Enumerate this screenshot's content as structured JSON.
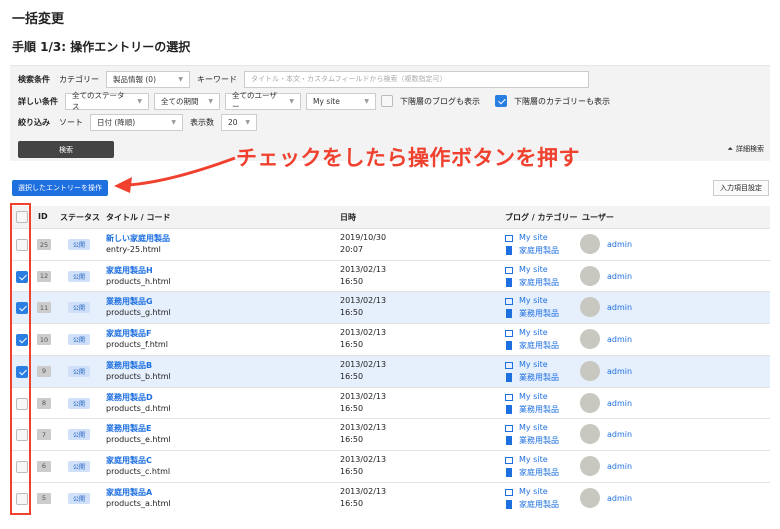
{
  "page": {
    "title": "一括変更",
    "step": "手順 1/3: 操作エントリーの選択"
  },
  "filter": {
    "search_label": "検索条件",
    "category_label": "カテゴリー",
    "category_value": "製品情報 (0)",
    "keyword_label": "キーワード",
    "keyword_placeholder": "タイトル・本文・カスタムフィールドから検索（複数指定可）",
    "detail_label": "詳しい条件",
    "status_value": "全てのステータス",
    "period_value": "全ての期間",
    "user_value": "全てのユーザー",
    "site_value": "My site",
    "sub_blog_label": "下階層のブログも表示",
    "sub_blog_checked": false,
    "sub_cat_label": "下階層のカテゴリーも表示",
    "sub_cat_checked": true,
    "narrow_label": "絞り込み",
    "sort_label": "ソート",
    "sort_value": "日付 (降順)",
    "count_label": "表示数",
    "count_value": "20",
    "search_button": "検索",
    "advanced_label": "詳細検索"
  },
  "annotation": {
    "text": "チェックをしたら操作ボタンを押す",
    "color": "#f0402e"
  },
  "actions": {
    "operate_button": "選択したエントリーを操作",
    "fields_button": "入力項目設定"
  },
  "table": {
    "headers": {
      "id": "ID",
      "status": "ステータス",
      "title": "タイトル / コード",
      "date": "日時",
      "blog": "ブログ / カテゴリー",
      "user": "ユーザー"
    },
    "rows": [
      {
        "id": "25",
        "status": "公開",
        "title": "新しい家庭用製品",
        "code": "entry-25.html",
        "date": "2019/10/30",
        "time": "20:07",
        "site": "My site",
        "category": "家庭用製品",
        "user": "admin",
        "checked": false,
        "highlight": false
      },
      {
        "id": "12",
        "status": "公開",
        "title": "家庭用製品H",
        "code": "products_h.html",
        "date": "2013/02/13",
        "time": "16:50",
        "site": "My site",
        "category": "家庭用製品",
        "user": "admin",
        "checked": true,
        "highlight": false
      },
      {
        "id": "11",
        "status": "公開",
        "title": "業務用製品G",
        "code": "products_g.html",
        "date": "2013/02/13",
        "time": "16:50",
        "site": "My site",
        "category": "業務用製品",
        "user": "admin",
        "checked": true,
        "highlight": true
      },
      {
        "id": "10",
        "status": "公開",
        "title": "家庭用製品F",
        "code": "products_f.html",
        "date": "2013/02/13",
        "time": "16:50",
        "site": "My site",
        "category": "家庭用製品",
        "user": "admin",
        "checked": true,
        "highlight": false
      },
      {
        "id": "9",
        "status": "公開",
        "title": "業務用製品B",
        "code": "products_b.html",
        "date": "2013/02/13",
        "time": "16:50",
        "site": "My site",
        "category": "業務用製品",
        "user": "admin",
        "checked": true,
        "highlight": true
      },
      {
        "id": "8",
        "status": "公開",
        "title": "業務用製品D",
        "code": "products_d.html",
        "date": "2013/02/13",
        "time": "16:50",
        "site": "My site",
        "category": "業務用製品",
        "user": "admin",
        "checked": false,
        "highlight": false
      },
      {
        "id": "7",
        "status": "公開",
        "title": "業務用製品E",
        "code": "products_e.html",
        "date": "2013/02/13",
        "time": "16:50",
        "site": "My site",
        "category": "業務用製品",
        "user": "admin",
        "checked": false,
        "highlight": false
      },
      {
        "id": "6",
        "status": "公開",
        "title": "家庭用製品C",
        "code": "products_c.html",
        "date": "2013/02/13",
        "time": "16:50",
        "site": "My site",
        "category": "家庭用製品",
        "user": "admin",
        "checked": false,
        "highlight": false
      },
      {
        "id": "5",
        "status": "公開",
        "title": "家庭用製品A",
        "code": "products_a.html",
        "date": "2013/02/13",
        "time": "16:50",
        "site": "My site",
        "category": "家庭用製品",
        "user": "admin",
        "checked": false,
        "highlight": false
      }
    ]
  }
}
